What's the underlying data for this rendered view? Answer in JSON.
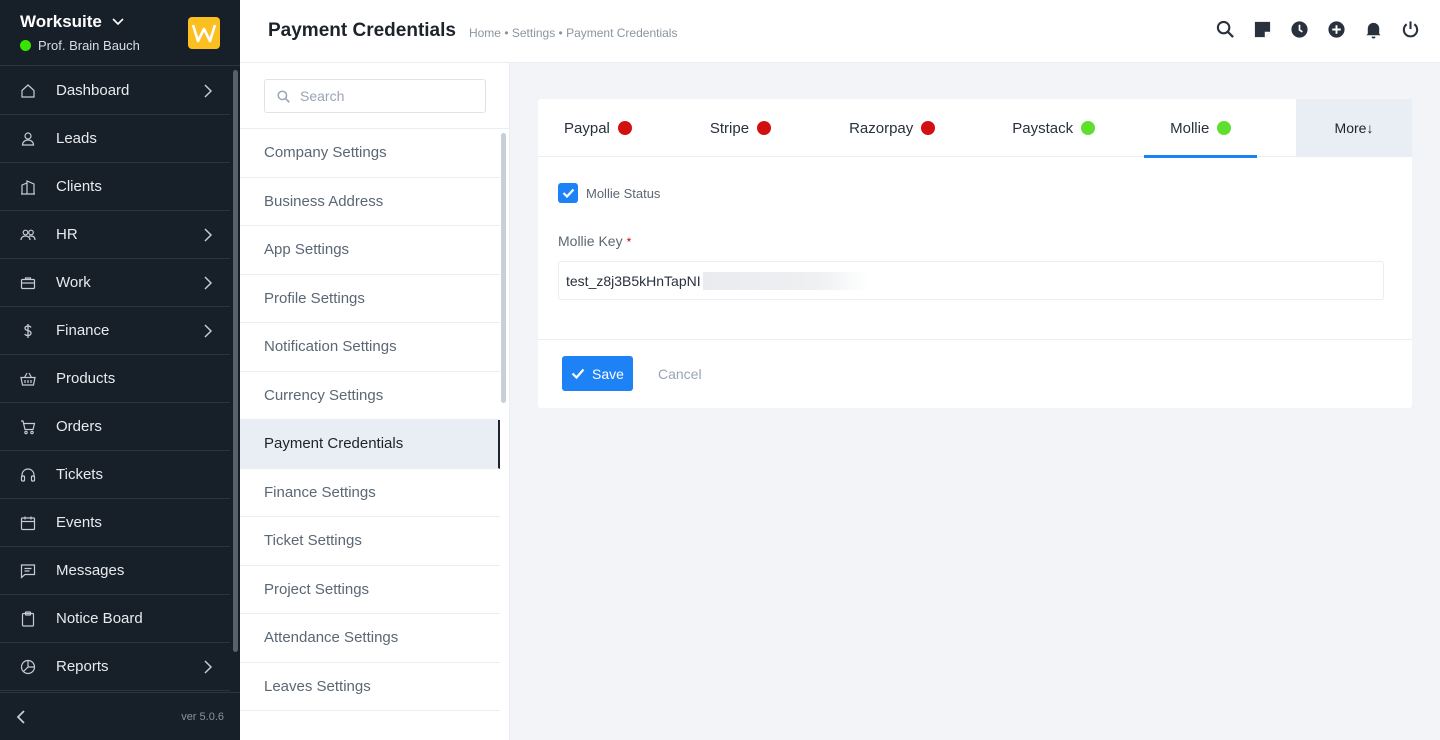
{
  "app": {
    "name": "Worksuite",
    "user": "Prof. Brain Bauch",
    "version": "ver 5.0.6",
    "logo_letter": "W",
    "colors": {
      "sidebar": "#171f29",
      "accent": "#1d82f5",
      "online": "#39e500",
      "logo": "#fbbf20"
    }
  },
  "sidebar": {
    "items": [
      {
        "label": "Dashboard",
        "icon": "house-icon",
        "has_children": true
      },
      {
        "label": "Leads",
        "icon": "person-icon",
        "has_children": false
      },
      {
        "label": "Clients",
        "icon": "building-icon",
        "has_children": false
      },
      {
        "label": "HR",
        "icon": "people-icon",
        "has_children": true
      },
      {
        "label": "Work",
        "icon": "briefcase-icon",
        "has_children": true
      },
      {
        "label": "Finance",
        "icon": "dollar-icon",
        "has_children": true
      },
      {
        "label": "Products",
        "icon": "basket-icon",
        "has_children": false
      },
      {
        "label": "Orders",
        "icon": "cart-icon",
        "has_children": false
      },
      {
        "label": "Tickets",
        "icon": "headset-icon",
        "has_children": false
      },
      {
        "label": "Events",
        "icon": "calendar-icon",
        "has_children": false
      },
      {
        "label": "Messages",
        "icon": "message-icon",
        "has_children": false
      },
      {
        "label": "Notice Board",
        "icon": "clipboard-icon",
        "has_children": false
      },
      {
        "label": "Reports",
        "icon": "pie-chart-icon",
        "has_children": true
      }
    ]
  },
  "header": {
    "title": "Payment Credentials",
    "breadcrumb": "Home • Settings • Payment Credentials",
    "icons": [
      "search-icon",
      "sticky-note-icon",
      "clock-icon",
      "add-circle-icon",
      "bell-icon",
      "power-icon"
    ]
  },
  "settings": {
    "search_placeholder": "Search",
    "items": [
      "Company Settings",
      "Business Address",
      "App Settings",
      "Profile Settings",
      "Notification Settings",
      "Currency Settings",
      "Payment Credentials",
      "Finance Settings",
      "Ticket Settings",
      "Project Settings",
      "Attendance Settings",
      "Leaves Settings"
    ],
    "active_index": 6
  },
  "payment": {
    "tabs": [
      {
        "label": "Paypal",
        "status_color": "#d21010"
      },
      {
        "label": "Stripe",
        "status_color": "#d21010"
      },
      {
        "label": "Razorpay",
        "status_color": "#d21010"
      },
      {
        "label": "Paystack",
        "status_color": "#5fe02f"
      },
      {
        "label": "Mollie",
        "status_color": "#5fe02f"
      }
    ],
    "active_tab": 4,
    "more_label": "More↓",
    "status_label": "Mollie Status",
    "status_checked": true,
    "key_label": "Mollie Key",
    "required_mark": "*",
    "key_value": "test_z8j3B5kHnTapNI",
    "save_label": "Save",
    "cancel_label": "Cancel"
  }
}
